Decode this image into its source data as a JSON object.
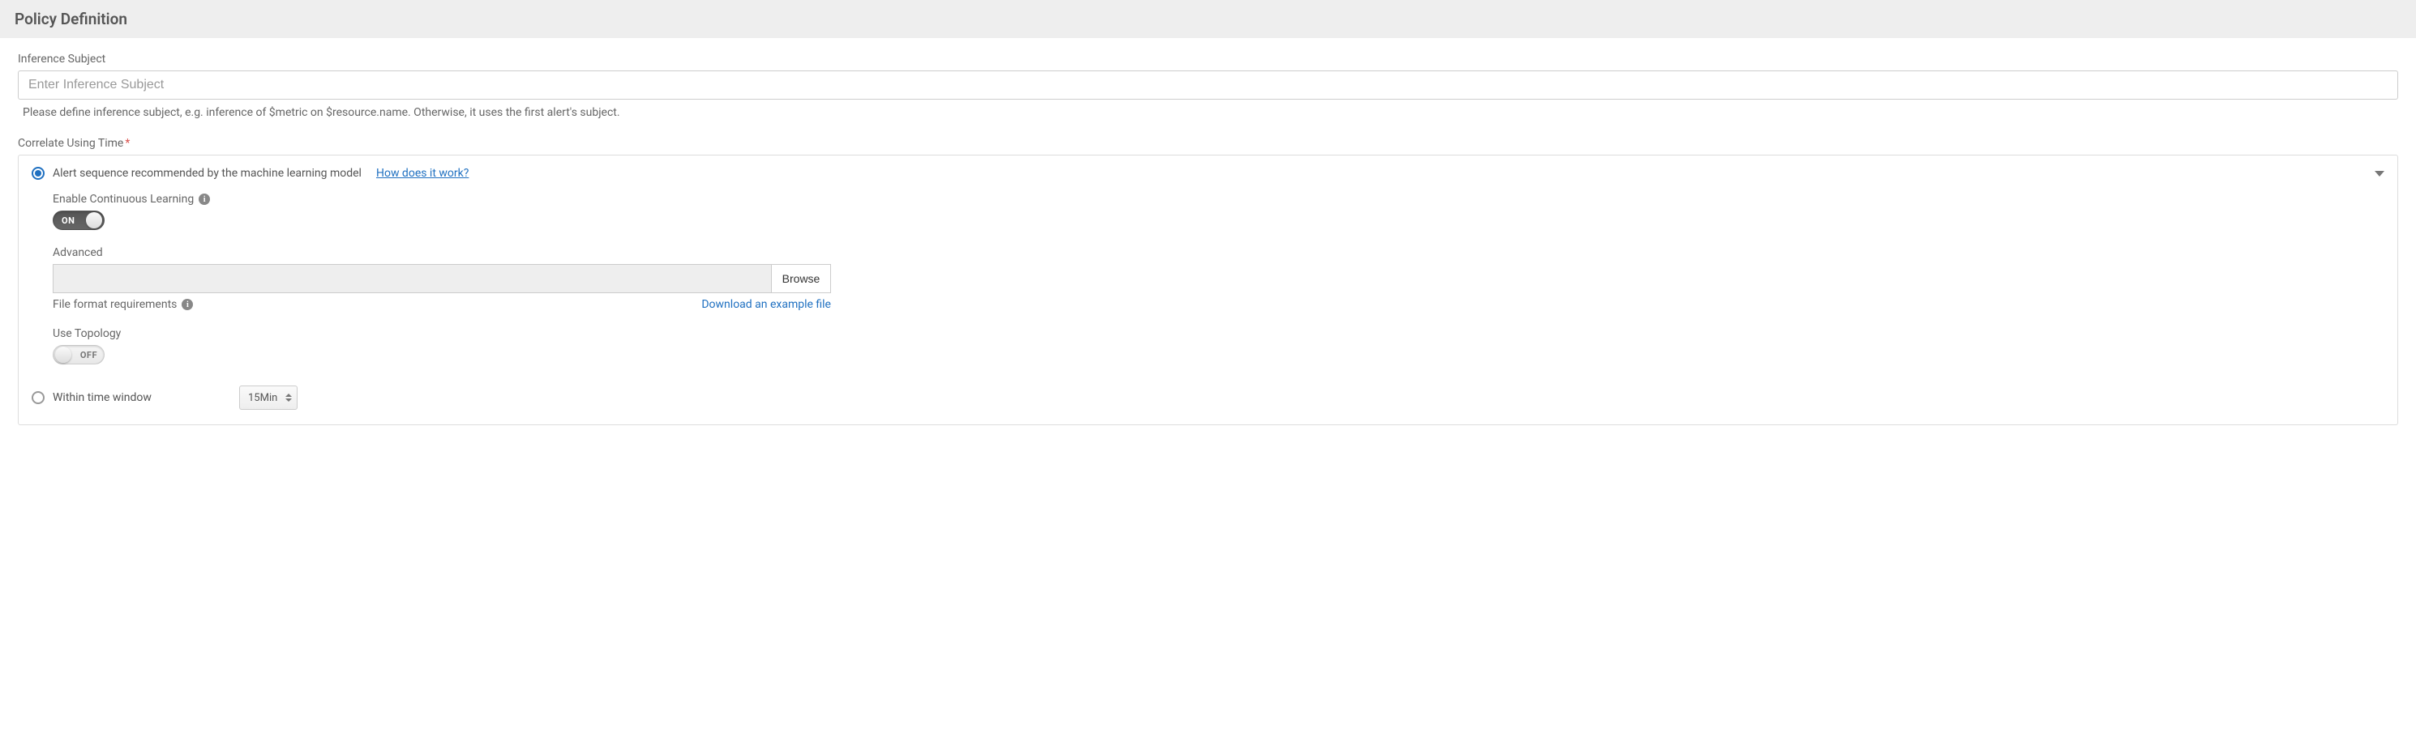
{
  "section": {
    "title": "Policy Definition"
  },
  "inference": {
    "label": "Inference Subject",
    "placeholder": "Enter Inference Subject",
    "help": "Please define inference subject, e.g. inference of $metric on $resource.name. Otherwise, it uses the first alert's subject."
  },
  "correlate": {
    "label": "Correlate Using Time",
    "option_ml": {
      "label": "Alert sequence recommended by the machine learning model",
      "how_link": "How does it work?"
    },
    "continuous_learning": {
      "label": "Enable Continuous Learning",
      "toggle_text": "ON"
    },
    "advanced": {
      "label": "Advanced",
      "browse": "Browse",
      "file_format": "File format requirements",
      "download_link": "Download an example file"
    },
    "topology": {
      "label": "Use Topology",
      "toggle_text": "OFF"
    },
    "option_window": {
      "label": "Within time window",
      "value": "15Min"
    }
  }
}
